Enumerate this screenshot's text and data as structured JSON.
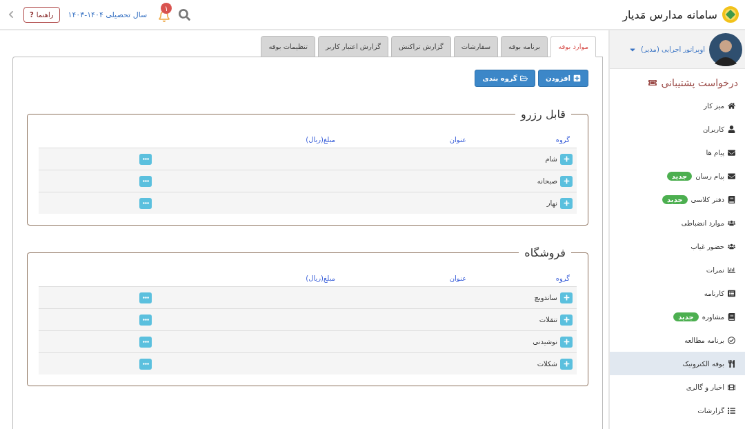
{
  "header": {
    "title": "سامانه مدارس مَدیار",
    "academic_year": "سال تحصیلی ۱۴۰۴-۱۴۰۳",
    "notification_count": "۱",
    "help_button": {
      "icon": "?",
      "label": "راهنما"
    }
  },
  "sidebar": {
    "user": "اوپراتور اجرایی (مدیر)",
    "support": "درخواست پشتیبانی",
    "items": [
      {
        "label": "میز کار",
        "selected": false
      },
      {
        "label": "کاربران",
        "selected": false
      },
      {
        "label": "پیام ها",
        "selected": false
      },
      {
        "label": "پیام رسان",
        "badge": "جدید",
        "selected": false
      },
      {
        "label": "دفتر کلاسی",
        "badge": "جدید",
        "selected": false
      },
      {
        "label": "موارد انضباطی",
        "selected": false
      },
      {
        "label": "حضور غیاب",
        "selected": false
      },
      {
        "label": "نمرات",
        "selected": false
      },
      {
        "label": "کارنامه",
        "selected": false
      },
      {
        "label": "مشاوره",
        "badge": "جدید",
        "selected": false
      },
      {
        "label": "برنامه مطالعه",
        "selected": false
      },
      {
        "label": "بوفه الکترونیک",
        "selected": true
      },
      {
        "label": "اخبار و گالری",
        "selected": false
      },
      {
        "label": "گزارشات",
        "selected": false
      }
    ]
  },
  "tabs": [
    {
      "label": "موارد بوفه",
      "selected": true
    },
    {
      "label": "برنامه بوفه",
      "selected": false
    },
    {
      "label": "سفارشات",
      "selected": false
    },
    {
      "label": "گزارش تراکنش",
      "selected": false
    },
    {
      "label": "گزارش اعتبار کاربر",
      "selected": false
    },
    {
      "label": "تنظیمات بوفه",
      "selected": false
    }
  ],
  "toolbar": {
    "buttons": [
      "افزودن",
      "گروه بندی"
    ]
  },
  "sections": [
    {
      "title": "قابل رزرو",
      "columns": [
        "گروه",
        "عنوان",
        "مبلغ(ریال)"
      ],
      "rows": [
        {
          "group": "شام"
        },
        {
          "group": "صبحانه"
        },
        {
          "group": "نهار"
        }
      ]
    },
    {
      "title": "فروشگاه",
      "columns": [
        "گروه",
        "عنوان",
        "مبلغ(ریال)"
      ],
      "rows": [
        {
          "group": "ساندویچ"
        },
        {
          "group": "تنقلات"
        },
        {
          "group": "نوشیدنی"
        },
        {
          "group": "شکلات"
        }
      ]
    }
  ]
}
